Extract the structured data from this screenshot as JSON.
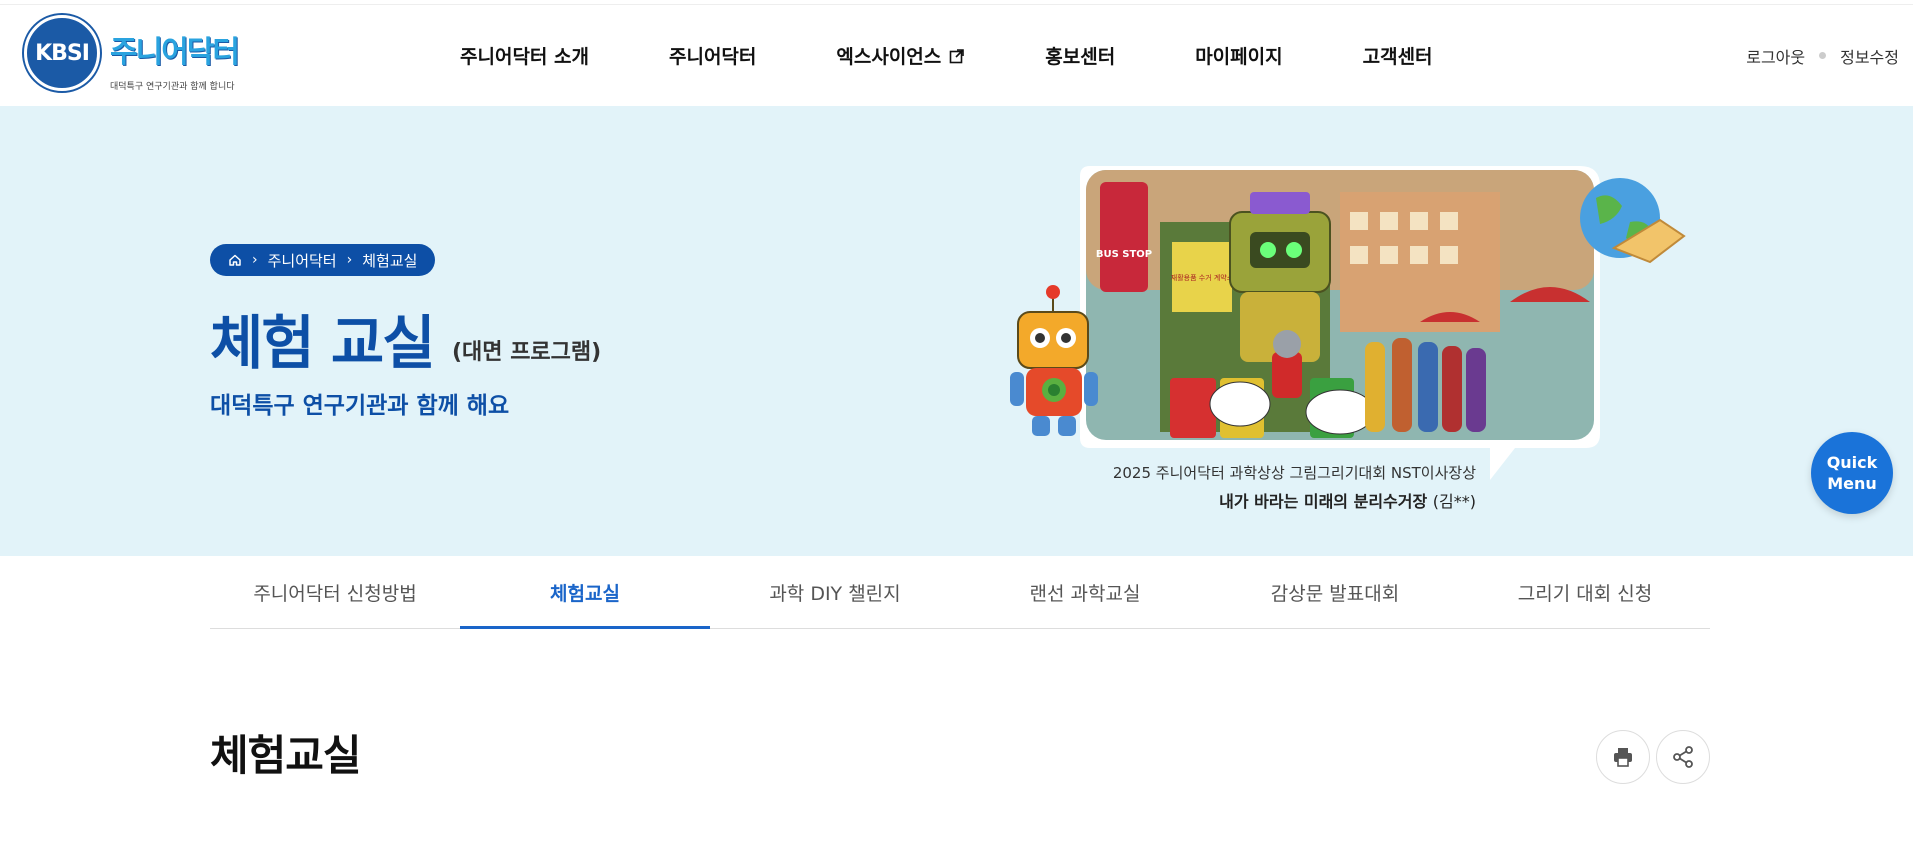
{
  "header": {
    "logo": {
      "badge_text": "KBSI",
      "title": "주니어닥터",
      "subtitle": "대덕특구 연구기관과 함께 합니다"
    },
    "nav": [
      {
        "label": "주니어닥터 소개"
      },
      {
        "label": "주니어닥터"
      },
      {
        "label": "엑스사이언스",
        "icon": "external-link-icon"
      },
      {
        "label": "홍보센터"
      },
      {
        "label": "마이페이지"
      },
      {
        "label": "고객센터"
      }
    ],
    "util": {
      "logout": "로그아웃",
      "edit_profile": "정보수정"
    }
  },
  "hero": {
    "breadcrumb": [
      "주니어닥터",
      "체험교실"
    ],
    "title": "체험 교실",
    "title_sub": "(대면 프로그램)",
    "description": "대덕특구 연구기관과 함께 해요",
    "caption_line1": "2025 주니어닥터 과학상상 그림그리기대회 NST이사장상",
    "caption_title": "내가 바라는 미래의 분리수거장",
    "caption_author": "(김**)",
    "art_texts": {
      "bus_stop": "BUS STOP",
      "sign": "재활용품 수거 계약소"
    },
    "background": "#e2f3f9"
  },
  "quick_menu": {
    "line1": "Quick",
    "line2": "Menu"
  },
  "tabs": [
    {
      "label": "주니어닥터 신청방법",
      "active": false
    },
    {
      "label": "체험교실",
      "active": true
    },
    {
      "label": "과학 DIY 챌린지",
      "active": false
    },
    {
      "label": "랜선 과학교실",
      "active": false
    },
    {
      "label": "감상문 발표대회",
      "active": false
    },
    {
      "label": "그리기 대회 신청",
      "active": false
    }
  ],
  "content": {
    "page_title": "체험교실",
    "tools": [
      "print-icon",
      "share-icon"
    ]
  },
  "colors": {
    "accent": "#1a65c9",
    "brand_dark": "#0d4fa6",
    "quick_menu": "#1a73d9"
  }
}
